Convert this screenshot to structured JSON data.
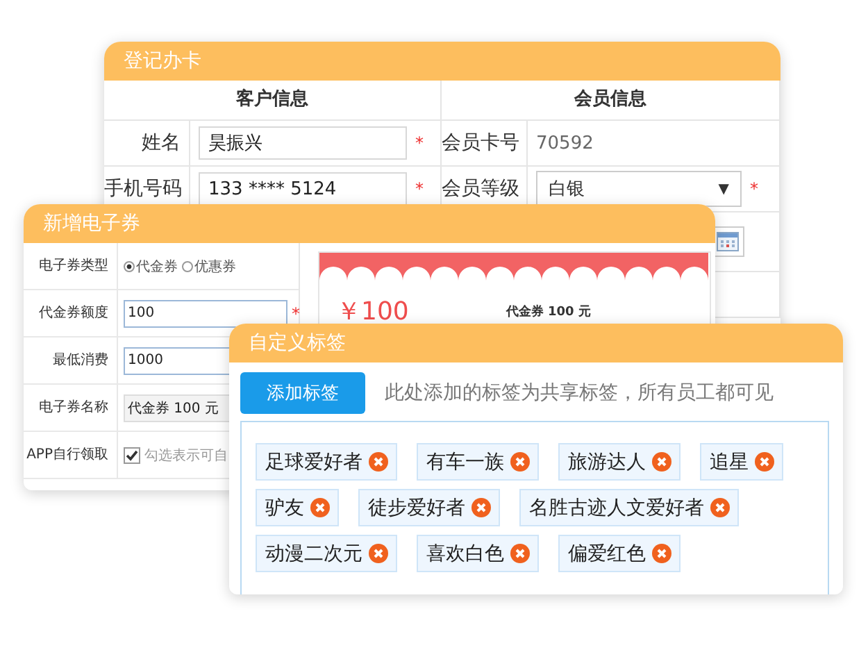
{
  "register_card": {
    "title": "登记办卡",
    "sections": [
      "客户信息",
      "会员信息"
    ],
    "left_rows": [
      {
        "label": "姓名",
        "value": "昊振兴",
        "mark": "*"
      },
      {
        "label": "手机号码",
        "value": "133 **** 5124",
        "mark": "*"
      }
    ],
    "right_rows": [
      {
        "kind": "text",
        "label": "会员卡号",
        "value": "70592"
      },
      {
        "kind": "select",
        "label": "会员等级",
        "value": "白银",
        "caret": "▼",
        "mark": "*"
      },
      {
        "kind": "date"
      }
    ]
  },
  "coupon": {
    "title": "新增电子券",
    "rows": [
      {
        "kind": "radio",
        "label": "电子券类型",
        "options": [
          {
            "label": "代金券",
            "selected": true
          },
          {
            "label": "优惠券",
            "selected": false
          }
        ]
      },
      {
        "kind": "input",
        "label": "代金券额度",
        "value": "100",
        "mark": "*"
      },
      {
        "kind": "input",
        "label": "最低消费",
        "value": "1000"
      },
      {
        "kind": "readonly",
        "label": "电子券名称",
        "value": "代金券 100 元"
      },
      {
        "kind": "checkbox",
        "label": "APP自行领取",
        "checked": true,
        "text": "勾选表示可自"
      }
    ],
    "preview": {
      "amount": "￥100",
      "name": "代金券 100 元"
    }
  },
  "tags_panel": {
    "title": "自定义标签",
    "add_button": "添加标签",
    "hint": "此处添加的标签为共享标签，所有员工都可见",
    "tags": [
      "足球爱好者",
      "有车一族",
      "旅游达人",
      "追星",
      "驴友",
      "徒步爱好者",
      "名胜古迹人文爱好者",
      "动漫二次元",
      "喜欢白色",
      "偏爱红色"
    ]
  }
}
